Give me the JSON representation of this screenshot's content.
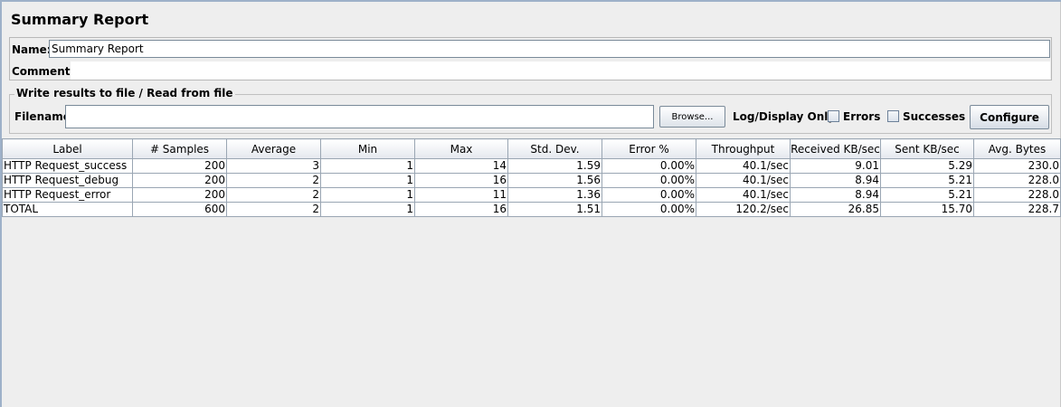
{
  "title": "Summary Report",
  "name_label": "Name:",
  "name_value": "Summary Report",
  "comments_label": "Comments:",
  "file_group_title": "Write results to file / Read from file",
  "filename_label": "Filename",
  "filename_value": "",
  "browse_label": "Browse...",
  "log_display_label": "Log/Display Only:",
  "errors_label": "Errors",
  "successes_label": "Successes",
  "errors_checked": false,
  "successes_checked": false,
  "configure_label": "Configure",
  "table": {
    "columns": [
      "Label",
      "# Samples",
      "Average",
      "Min",
      "Max",
      "Std. Dev.",
      "Error %",
      "Throughput",
      "Received KB/sec",
      "Sent KB/sec",
      "Avg. Bytes"
    ],
    "rows": [
      [
        "HTTP Request_success",
        "200",
        "3",
        "1",
        "14",
        "1.59",
        "0.00%",
        "40.1/sec",
        "9.01",
        "5.29",
        "230.0"
      ],
      [
        "HTTP Request_debug",
        "200",
        "2",
        "1",
        "16",
        "1.56",
        "0.00%",
        "40.1/sec",
        "8.94",
        "5.21",
        "228.0"
      ],
      [
        "HTTP Request_error",
        "200",
        "2",
        "1",
        "11",
        "1.36",
        "0.00%",
        "40.1/sec",
        "8.94",
        "5.21",
        "228.0"
      ],
      [
        "TOTAL",
        "600",
        "2",
        "1",
        "16",
        "1.51",
        "0.00%",
        "120.2/sec",
        "26.85",
        "15.70",
        "228.7"
      ]
    ]
  }
}
